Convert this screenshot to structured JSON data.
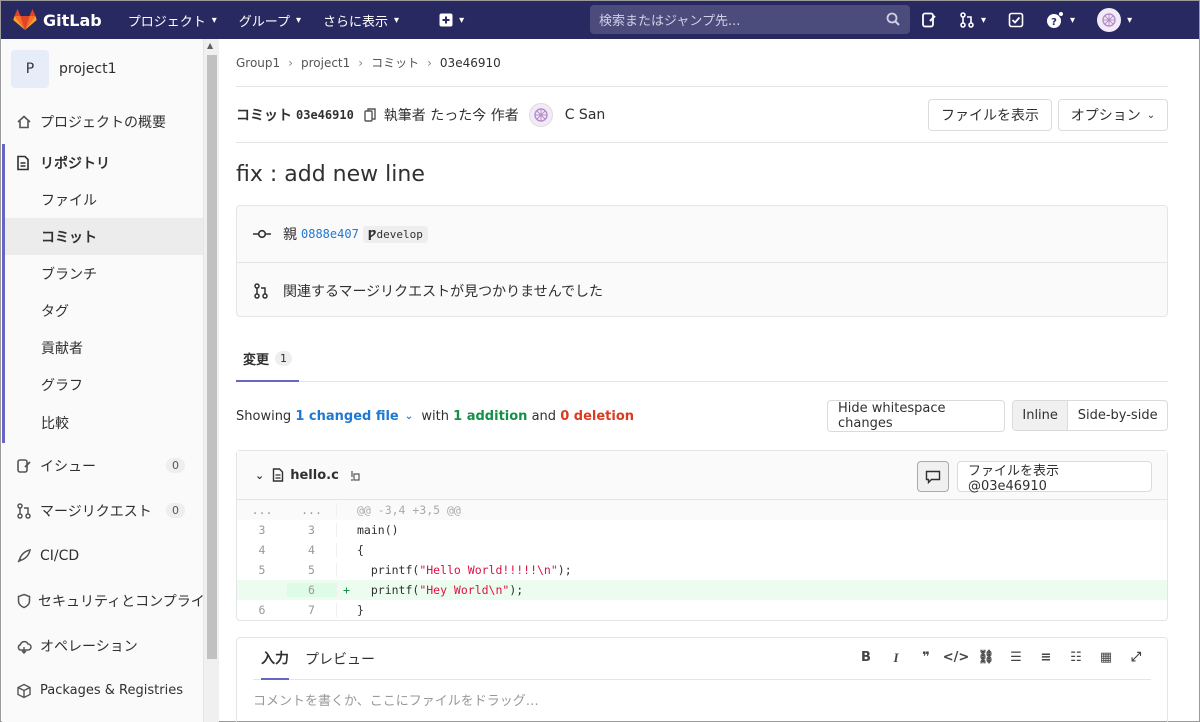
{
  "navbar": {
    "brand": "GitLab",
    "menu": [
      {
        "label": "プロジェクト"
      },
      {
        "label": "グループ"
      },
      {
        "label": "さらに表示"
      }
    ],
    "search_placeholder": "検索またはジャンプ先..."
  },
  "sidebar": {
    "project_initial": "P",
    "project_name": "project1",
    "items": [
      {
        "label": "プロジェクトの概要",
        "icon": "home-icon"
      },
      {
        "label": "リポジトリ",
        "icon": "document-icon"
      }
    ],
    "repo_sub": [
      {
        "label": "ファイル"
      },
      {
        "label": "コミット"
      },
      {
        "label": "ブランチ"
      },
      {
        "label": "タグ"
      },
      {
        "label": "貢献者"
      },
      {
        "label": "グラフ"
      },
      {
        "label": "比較"
      }
    ],
    "lower": [
      {
        "label": "イシュー",
        "badge": "0",
        "icon": "issues-icon"
      },
      {
        "label": "マージリクエスト",
        "badge": "0",
        "icon": "merge-request-icon"
      },
      {
        "label": "CI/CD",
        "icon": "rocket-icon"
      },
      {
        "label": "セキュリティとコンプライアンス",
        "icon": "shield-icon"
      },
      {
        "label": "オペレーション",
        "icon": "cloud-icon"
      },
      {
        "label": "Packages & Registries",
        "icon": "package-icon"
      }
    ]
  },
  "breadcrumb": [
    "Group1",
    "project1",
    "コミット",
    "03e46910"
  ],
  "commit": {
    "label": "コミット",
    "sha": "03e46910",
    "authored": "執筆者 たった今 作者",
    "author": "C San",
    "view_files": "ファイルを表示",
    "options": "オプション",
    "title": "fix : add new line",
    "parent_label": "親",
    "parent_sha": "0888e407",
    "branch": "develop",
    "mr_text": "関連するマージリクエストが見つかりませんでした"
  },
  "tabs": {
    "changes_label": "変更",
    "changes_count": "1"
  },
  "summary": {
    "showing": "Showing",
    "changed": "1 changed file",
    "with": "with",
    "additions": "1 addition",
    "and": "and",
    "deletions": "0 deletion",
    "hide_ws": "Hide whitespace changes",
    "inline": "Inline",
    "side_by_side": "Side-by-side"
  },
  "diff": {
    "file": "hello.c",
    "view_file": "ファイルを表示 @03e46910",
    "hunk": "@@ -3,4 +3,5 @@",
    "lines": [
      {
        "old": "3",
        "new": "3",
        "sign": "",
        "code": "main()"
      },
      {
        "old": "4",
        "new": "4",
        "sign": "",
        "code": "{"
      },
      {
        "old": "5",
        "new": "5",
        "sign": "",
        "code": "  printf(\"Hello World!!!!!\\n\");"
      },
      {
        "old": "",
        "new": "6",
        "sign": "+",
        "code": "  printf(\"Hey World\\n\");"
      },
      {
        "old": "6",
        "new": "7",
        "sign": "",
        "code": "}"
      }
    ]
  },
  "comment": {
    "write_tab": "入力",
    "preview_tab": "プレビュー",
    "placeholder": "コメントを書くか、ここにファイルをドラッグ…"
  },
  "colors": {
    "navbar": "#292961",
    "accent": "#6666c4",
    "addition": "#168f48",
    "deletion": "#db3b21",
    "link": "#1f78d1"
  }
}
